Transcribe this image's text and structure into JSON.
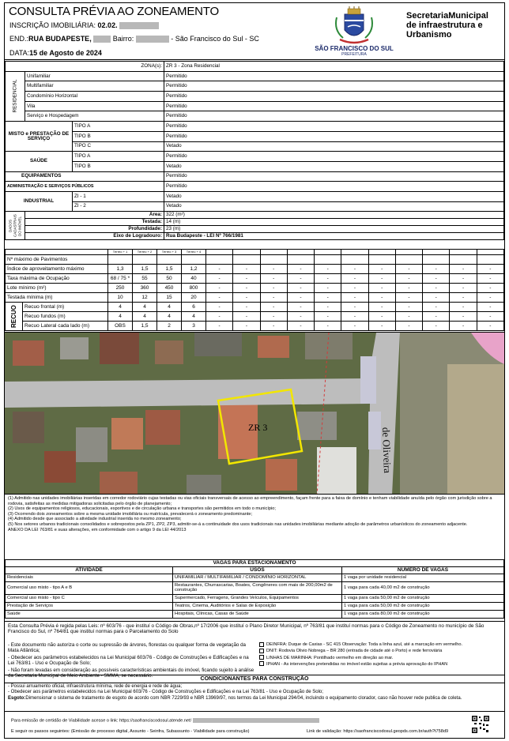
{
  "header": {
    "title": "CONSULTA PRÉVIA AO ZONEAMENTO",
    "inscricao_label": "INSCRIÇÃO IMOBILIÁRIA:",
    "inscricao_value": "02.02.",
    "end_label": "END.:",
    "end_value": "RUA BUDAPESTE,",
    "bairro_label": "Bairro:",
    "city": "- São Francisco do Sul - SC",
    "data_label": "DATA:",
    "data_value": "15 de Agosto de 2024"
  },
  "logo": {
    "name": "SÃO FRANCISCO DO SUL",
    "sub": "PREFEITURA"
  },
  "secretaria": {
    "line1": "SecretariaMunicipal",
    "line2": "de infraestrutura e",
    "line3": "Urbanismo"
  },
  "zona": {
    "label": "ZONA(s):",
    "value": "ZR 3 - Zona Residencial"
  },
  "groups": {
    "residencial": "RESIDENCIAL",
    "misto": "MISTO e PRESTAÇÃO DE SERVIÇO",
    "saude": "SAÚDE",
    "equipamentos": "EQUIPAMENTOS",
    "adm": "ADMINISTRAÇÃO E SERVIÇOS PÚBLICOS",
    "industrial": "INDUSTRIAL",
    "dados": "DADOS CADASTRAIS DO IMÓVEL"
  },
  "uses": {
    "residencial": [
      [
        "Unifamiliar",
        "Permitido"
      ],
      [
        "Multifamiliar",
        "Permitido"
      ],
      [
        "Condomínio Horizontal",
        "Permitido"
      ],
      [
        "Vila",
        "Permitido"
      ],
      [
        "Serviço e Hospedagem",
        "Permitido"
      ]
    ],
    "misto": [
      [
        "TIPO A",
        "Permitido"
      ],
      [
        "TIPO B",
        "Permitido"
      ],
      [
        "TIPO C",
        "Vetado"
      ]
    ],
    "saude": [
      [
        "TIPO A",
        "Permitido"
      ],
      [
        "TIPO B",
        "Vetado"
      ]
    ],
    "equipamentos": "Permitido",
    "adm": "Permitido",
    "industrial": [
      [
        "ZI - 1",
        "Vetado"
      ],
      [
        "ZI - 2",
        "Vetado"
      ]
    ]
  },
  "cadastro": [
    [
      "Área:",
      "322 (m²)"
    ],
    [
      "Testada:",
      "14 (m)"
    ],
    [
      "Profundidade:",
      "23 (m)"
    ],
    [
      "Eixo de Logradouro:",
      "Rua Budapeste - LEI Nº 766/1981"
    ]
  ],
  "params": {
    "recuo_label": "RECUO",
    "tiny": [
      "Térreo + 1",
      "Térreo + 2",
      "Térreo + 3",
      "Térreo + 4"
    ],
    "rows": [
      [
        "Nº máximo de Pavimentos",
        "",
        "",
        "",
        ""
      ],
      [
        "Índice de aproveitamento máximo",
        "1,3",
        "1,5",
        "1,5",
        "1,2"
      ],
      [
        "Taxa máxima de Ocupação",
        "68 / 75 * 55",
        "",
        "50",
        "40"
      ],
      [
        "Lote mínimo (m²)",
        "250",
        "360",
        "450",
        "800"
      ],
      [
        "Testada mínima (m)",
        "10",
        "12",
        "15",
        "20"
      ]
    ],
    "row_ocup": [
      "68 / 75 *",
      "55",
      "50",
      "40"
    ],
    "recuos": [
      [
        "Recuo frontal (m)",
        "4",
        "4",
        "4",
        "6"
      ],
      [
        "Recuo fundos (m)",
        "4",
        "4",
        "4",
        "4"
      ],
      [
        "Recuo Lateral cada lado (m)",
        "OBS",
        "1,5",
        "2",
        "3"
      ]
    ],
    "dash": "-"
  },
  "map": {
    "zone_label": "ZR 3",
    "street_label": "de Oliveira"
  },
  "notes": [
    "(1) Admitido nas unidades imobiliárias inseridas em corredor rodoviário cujas testadas ou vias oficiais transversais de acesso ao empreendimento, façam frente para a faixa de domínio e tenham viabilidade anuída pelo órgão com jurisdição sobre a rodovia, satisfeitas as medidas mitigadoras solicitadas pelo órgão de planejamento;",
    "(2) Usos de equipamentos religiosos, educacionais, esportivos e de circulação urbana e transportes são permitidos em todo o município;",
    "(3) Ocorrendo dois zoneamentos sobre a mesma unidade imobiliária ou matrícula, prevalecerá o zoneamento predominante;",
    "(4) Admitido desde que associado a atividade industrial inserida no mesmo zoneamento;",
    "(5) Nos setores urbanos tradicionais consolidados e sobrepostos pela ZP1, ZP2, ZP3, admitir-se-á a continuidade dos usos tradicionais nas unidades imobiliárias mediante adoção de parâmetros urbanísticos do zoneamento adjacente.",
    "ANEXO DA LEI 763/81 e suas alterações, em conformidade com o artigo 9 da LEI 44/2013"
  ],
  "parking": {
    "title": "VAGAS PARA ESTACIONAMENTO",
    "headers": [
      "ATIVIDADE",
      "USOS",
      "NÚMERO DE VAGAS"
    ],
    "rows": [
      [
        "Residenciais",
        "UNIFAMILIAR / MULTIFAMILIAR / CONDOMÍNIO HORIZONTAL",
        "1 vaga por unidade residencial"
      ],
      [
        "Comercial uso misto - tipo A e B",
        "Restaurantes, Churrascarias, Boates, Congêneres com mais de 200,00m2 de construção",
        "1 vaga para cada 40,00 m2 de construção"
      ],
      [
        "Comercial uso misto - tipo C",
        "Supermercado, Ferragens, Grandes Veículos, Equipamentos",
        "1 vaga para cada 50,00 m2 de construção"
      ],
      [
        "Prestação de Serviços",
        "Teatros, Cinema, Auditórios e Salas de Exposição",
        "1 vaga para cada 50,00 m2 de construção"
      ],
      [
        "Saúde",
        "Hospitais, Clínicas, Casas de Saúde",
        "1 vaga para cada 80,00 m2 de construção"
      ]
    ]
  },
  "legal": {
    "top": "Esta Consulta Prévia é regida pelas Leis: nº 603/76 - que instituí o Código de Obras,nº 17/2006 que instituí o Plano Diretor Municipal, nº 763/81 que instituí normas para o Código de Zoneamento no município de São Francisco do Sul, nº 764/81 que instituí normas para o Parcelamento do Solo",
    "left": [
      "- Este documento não autoriza o corte ou supressão de árvores, florestas ou qualquer forma de vegetação da Mata Atlântica;",
      "- Obedecer aos parâmetros estabelecidos na Lei Municipal 603/76 - Código de Construções e Edificações e na Lei 763/81 - Uso e Ocupação de Solo;",
      "- Não foram levadas em consideração as possíveis características ambientais do imóvel, ficando sujeito à análise da Secretaria Municipal de Meio Ambiente - SMMA, se necessário."
    ],
    "right": [
      "DEINFRA: Duque de Caxias - SC 415 Observação: Toda a linha azul, até a marcação em vermelho.",
      "DNIT: Rodovia Olivio Nobrega – BR 280 (entrada de cidade até o Porto) e rede ferroviária",
      "LINHAS DE MARINHA: Pontilhado vermelho em direção ao mar.",
      "IPHAN - As intervenções pretendidas no imóvel estão sujeitas a prévia aprovação do IPHAN"
    ]
  },
  "condicionantes": {
    "title": "CONDICIONANTES PARA CONSTRUÇÃO",
    "lines": [
      "- Possui arruamento oficial, infraestrutura mínima, rede de energia e rede de água;",
      "- Obedecer aos parâmetros estabelecidos na Lei Municipal 603/76 - Código de Construções e Edificações e na Lei 763/81 - Uso e Ocupação de Solo;"
    ],
    "esgoto_label": "Esgoto:",
    "esgoto_text": "Dimensionar o sistema de tratamento de esgoto de acordo com NBR 7229/93 e NBR 13969/97, nos termos da Lei Municipal 294/04, incluindo o equipamento clorador, caso não houver rede publica de coleta."
  },
  "footer": {
    "line1": "Para emissão de certidão de Viabilidade acesse o link: https://saofranciscodosul.atende.net/",
    "line2": "E seguir os passos seguintes: (Emissão de processo digital, Assunto - Seinfra, Subassunto - Viabilidade para construção)",
    "line3": "Link de validação: https://saofranciscodosul.geopds.com.br/auth?t758d9"
  },
  "colors": {
    "zone_outline": "#f2e600",
    "pink_area": "#e8a3c9",
    "road": "#bdbdbd"
  }
}
